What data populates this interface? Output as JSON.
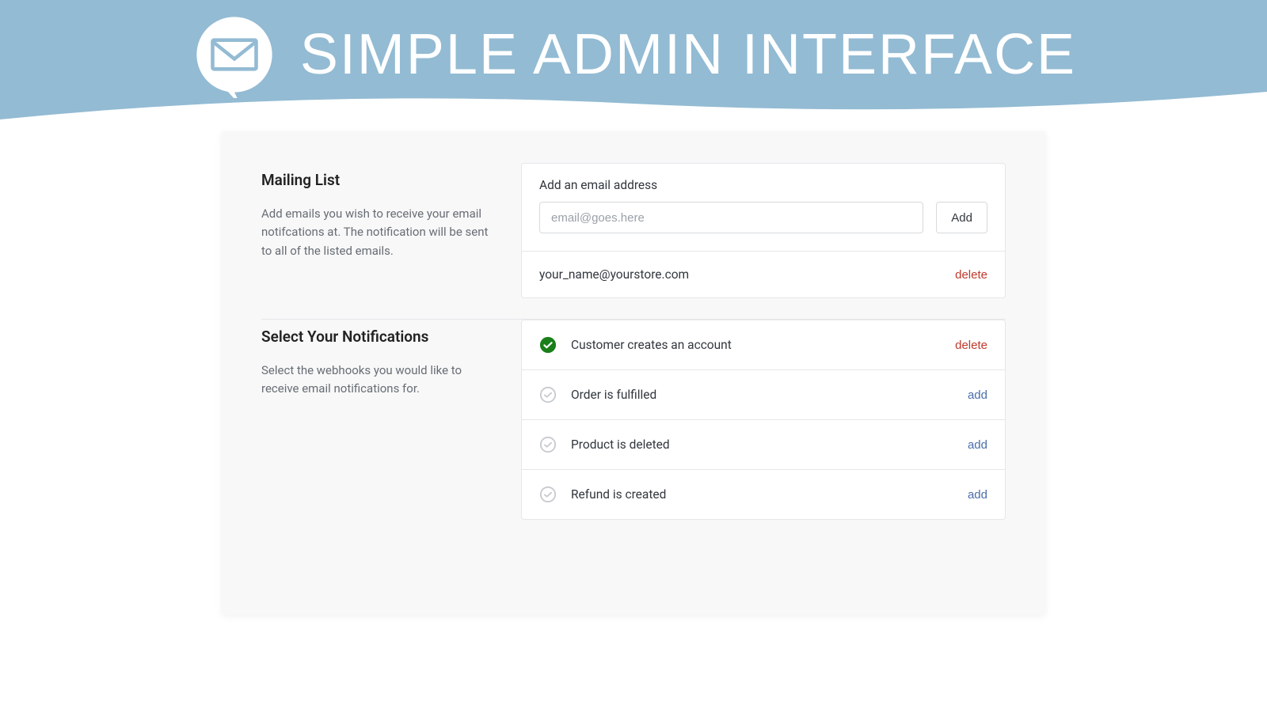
{
  "banner": {
    "title": "SIMPLE ADMIN INTERFACE"
  },
  "mailing": {
    "title": "Mailing List",
    "desc": "Add emails you wish to receive your email notifcations at. The notification will be sent to all of the listed emails.",
    "add_label": "Add an email address",
    "placeholder": "email@goes.here",
    "add_button": "Add",
    "emails": [
      {
        "address": "your_name@yourstore.com",
        "action": "delete"
      }
    ]
  },
  "notifications": {
    "title": "Select Your Notifications",
    "desc": "Select the webhooks you would like to receive email notifications for.",
    "items": [
      {
        "label": "Customer creates an account",
        "active": true,
        "action": "delete"
      },
      {
        "label": "Order is fulfilled",
        "active": false,
        "action": "add"
      },
      {
        "label": "Product is deleted",
        "active": false,
        "action": "add"
      },
      {
        "label": "Refund is created",
        "active": false,
        "action": "add"
      }
    ]
  },
  "colors": {
    "banner_bg": "#93bbd3",
    "active_check": "#1a7f1a",
    "delete_link": "#c0392b",
    "add_link": "#4a6ea9"
  }
}
